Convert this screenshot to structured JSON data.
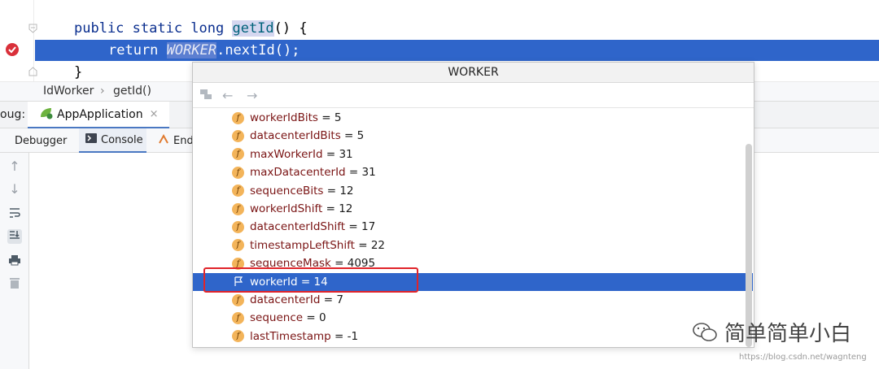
{
  "editor": {
    "line1": {
      "kw": "public static long ",
      "method": "getId",
      "rest": "() {"
    },
    "line2": {
      "kw": "return ",
      "const": "WORKER",
      "rest": ".nextId();"
    },
    "line3": {
      "text": "}"
    }
  },
  "breadcrumb": {
    "class_name": "IdWorker",
    "separator": "›",
    "method_name": "getId()"
  },
  "debug": {
    "label": "oug:",
    "app_tab": {
      "label": "AppApplication",
      "close": "×"
    }
  },
  "tool_tabs": [
    {
      "label": "Debugger"
    },
    {
      "label": "Console"
    },
    {
      "label": "End"
    }
  ],
  "popup": {
    "title": "WORKER",
    "fields": [
      {
        "name": "workerIdBits",
        "value": "5"
      },
      {
        "name": "datacenterIdBits",
        "value": "5"
      },
      {
        "name": "maxWorkerId",
        "value": "31"
      },
      {
        "name": "maxDatacenterId",
        "value": "31"
      },
      {
        "name": "sequenceBits",
        "value": "12"
      },
      {
        "name": "workerIdShift",
        "value": "12"
      },
      {
        "name": "datacenterIdShift",
        "value": "17"
      },
      {
        "name": "timestampLeftShift",
        "value": "22"
      },
      {
        "name": "sequenceMask",
        "value": "4095"
      },
      {
        "name": "workerId",
        "value": "14"
      },
      {
        "name": "datacenterId",
        "value": "7"
      },
      {
        "name": "sequence",
        "value": "0"
      },
      {
        "name": "lastTimestamp",
        "value": "-1"
      }
    ],
    "selected_field": "workerId",
    "equals": " = "
  },
  "watermark": {
    "text": "简单简单小白",
    "url": "https://blog.csdn.net/wagnteng"
  },
  "colors": {
    "selection": "#2f65ca",
    "highlight_box": "#e0242a",
    "field_icon": "#f3b45a"
  },
  "icons": [
    "breakpoint-icon",
    "fold-icon",
    "field-icon",
    "flag-icon",
    "back-arrow-icon",
    "forward-arrow-icon",
    "spring-app-icon",
    "console-icon",
    "endpoints-icon"
  ]
}
